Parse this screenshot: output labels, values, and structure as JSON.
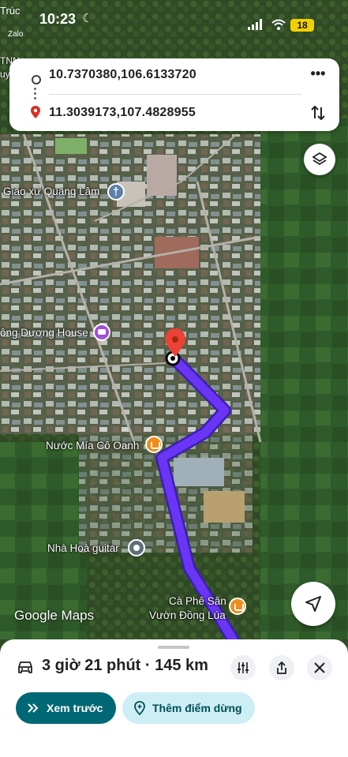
{
  "status_bar": {
    "carrier": "Trúc",
    "time": "10:23",
    "notification": "Zalo",
    "battery": "18"
  },
  "edge_labels": [
    "TNN",
    "uyệ"
  ],
  "route": {
    "origin": "10.7370380,106.6133720",
    "destination": "11.3039173,107.4828955"
  },
  "map": {
    "labels": {
      "church": "Giáo xứ Quang Lâm",
      "house": "ông Dương House",
      "drink": "Nước Mía Cô Oanh",
      "guitar": "Nhà Hoà guitar",
      "cafe_line1": "Cà Phê Sân",
      "cafe_line2": "Vườn Đồng Lúa"
    },
    "attribution": "Google Maps",
    "colors": {
      "route": "#5b2cf2",
      "pin": "#ea4335",
      "poi_blue": "#5f7fa8",
      "poi_purple": "#a14fd6",
      "poi_orange": "#f08c1a"
    }
  },
  "bottom_sheet": {
    "mode": "car-icon",
    "summary": "3 giờ 21 phút · 145 km",
    "preview_label": "Xem trước",
    "add_stop_label": "Thêm điểm dừng"
  }
}
